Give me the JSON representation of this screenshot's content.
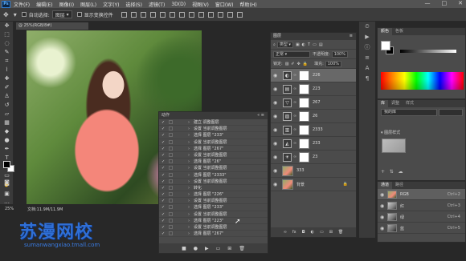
{
  "menubar": {
    "app_logo": "Ps",
    "items": [
      "文件(F)",
      "编辑(E)",
      "图像(I)",
      "图层(L)",
      "文字(Y)",
      "选择(S)",
      "滤镜(T)",
      "3D(D)",
      "视图(V)",
      "窗口(W)",
      "帮助(H)"
    ],
    "window_controls": [
      "—",
      "□",
      "✕"
    ]
  },
  "options": {
    "auto_select_label": "自动选择:",
    "auto_select_value": "图层",
    "show_transform_label": "显示变换控件"
  },
  "document": {
    "tab_label": "@ 25%(RGB/8#)",
    "zoom_status": "25%",
    "doc_status": "文档:11.9M/11.9M"
  },
  "watermark": {
    "title": "苏漫网校",
    "url": "sumanwangxiao.tmall.com"
  },
  "actions_panel": {
    "title": "动作",
    "rows": [
      "建立 调整图层",
      "设置 当前调整图层",
      "选择 图层 \"233\"",
      "设置 当前调整图层",
      "选择 图层 \"267\"",
      "设置 当前调整图层",
      "选择 图层 \"26\"",
      "设置 当前调整图层",
      "选择 图层 \"2333\"",
      "设置 当前调整图层",
      "转化",
      "选择 图层 \"226\"",
      "设置 当前调整图层",
      "选择 图层 \"233\"",
      "设置 当前调整图层",
      "选择 图层 \"223\"",
      "设置 当前调整图层",
      "选择 图层 \"267\""
    ]
  },
  "layers_panel": {
    "title": "图层",
    "filter_label": "类型",
    "blend_mode": "正常",
    "opacity_label": "不透明度:",
    "opacity_value": "100%",
    "lock_label": "锁定:",
    "fill_label": "填充:",
    "fill_value": "100%",
    "layers": [
      {
        "name": "226",
        "icon": "◐",
        "selected": true
      },
      {
        "name": "223",
        "icon": "▤",
        "selected": false
      },
      {
        "name": "267",
        "icon": "▽",
        "selected": false
      },
      {
        "name": "26",
        "icon": "▨",
        "selected": false
      },
      {
        "name": "2333",
        "icon": "▥",
        "selected": false
      },
      {
        "name": "233",
        "icon": "◭",
        "selected": false
      },
      {
        "name": "23",
        "icon": "☀",
        "selected": false
      },
      {
        "name": "333",
        "icon": "",
        "selected": false
      },
      {
        "name": "背景",
        "icon": "",
        "selected": false
      }
    ]
  },
  "color_panel": {
    "tabs": [
      "颜色",
      "色板"
    ]
  },
  "libraries_panel": {
    "tabs": [
      "库",
      "调整",
      "样式"
    ],
    "library_name": "我的库",
    "section_label": "▾ 图层样式"
  },
  "channels_panel": {
    "tabs": [
      "通道",
      "路径"
    ],
    "channels": [
      {
        "name": "RGB",
        "shortcut": "Ctrl+2"
      },
      {
        "name": "红",
        "shortcut": "Ctrl+3"
      },
      {
        "name": "绿",
        "shortcut": "Ctrl+4"
      },
      {
        "name": "蓝",
        "shortcut": "Ctrl+5"
      }
    ]
  },
  "colors": {
    "ui_bg": "#282828",
    "panel_bg": "#4b4b4b",
    "watermark_blue": "#2f6fd6"
  }
}
